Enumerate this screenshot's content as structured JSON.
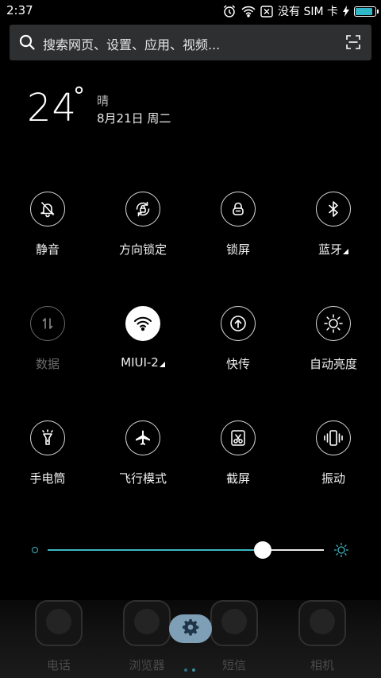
{
  "status_bar": {
    "time": "2:37",
    "sim_text": "没有 SIM 卡",
    "battery_level": 0.9,
    "icons": [
      "alarm-icon",
      "wifi-icon",
      "no-sim-icon",
      "charging-icon",
      "battery-icon"
    ]
  },
  "search": {
    "placeholder": "搜索网页、设置、应用、视频...",
    "icon": "search-icon",
    "scan_icon": "scan-icon"
  },
  "weather": {
    "temperature": "24",
    "degree": "°",
    "condition": "晴",
    "date": "8月21日 周二"
  },
  "toggles": [
    {
      "label": "静音",
      "icon": "silent-bell-icon",
      "state": "off",
      "dropdown": false
    },
    {
      "label": "方向锁定",
      "icon": "rotation-lock-icon",
      "state": "off",
      "dropdown": false
    },
    {
      "label": "锁屏",
      "icon": "lock-icon",
      "state": "off",
      "dropdown": false
    },
    {
      "label": "蓝牙",
      "icon": "bluetooth-icon",
      "state": "off",
      "dropdown": true
    },
    {
      "label": "数据",
      "icon": "mobile-data-icon",
      "state": "disabled",
      "dropdown": false
    },
    {
      "label": "MIUI-2",
      "icon": "wifi-icon",
      "state": "on",
      "dropdown": true
    },
    {
      "label": "快传",
      "icon": "quick-transfer-icon",
      "state": "off",
      "dropdown": false
    },
    {
      "label": "自动亮度",
      "icon": "auto-brightness-icon",
      "state": "off",
      "dropdown": false
    },
    {
      "label": "手电筒",
      "icon": "flashlight-icon",
      "state": "off",
      "dropdown": false
    },
    {
      "label": "飞行模式",
      "icon": "airplane-icon",
      "state": "off",
      "dropdown": false
    },
    {
      "label": "截屏",
      "icon": "screenshot-icon",
      "state": "off",
      "dropdown": false
    },
    {
      "label": "振动",
      "icon": "vibrate-icon",
      "state": "off",
      "dropdown": false
    }
  ],
  "brightness": {
    "level": 0.78,
    "accent_color": "#3ab6c2"
  },
  "dock": {
    "apps": [
      {
        "label": "电话",
        "icon": "phone-icon"
      },
      {
        "label": "浏览器",
        "icon": "browser-icon"
      },
      {
        "label": "短信",
        "icon": "messages-icon"
      },
      {
        "label": "相机",
        "icon": "camera-icon"
      }
    ],
    "settings_icon": "settings-gear-icon",
    "pager_pages": 2,
    "pager_active": 1
  }
}
